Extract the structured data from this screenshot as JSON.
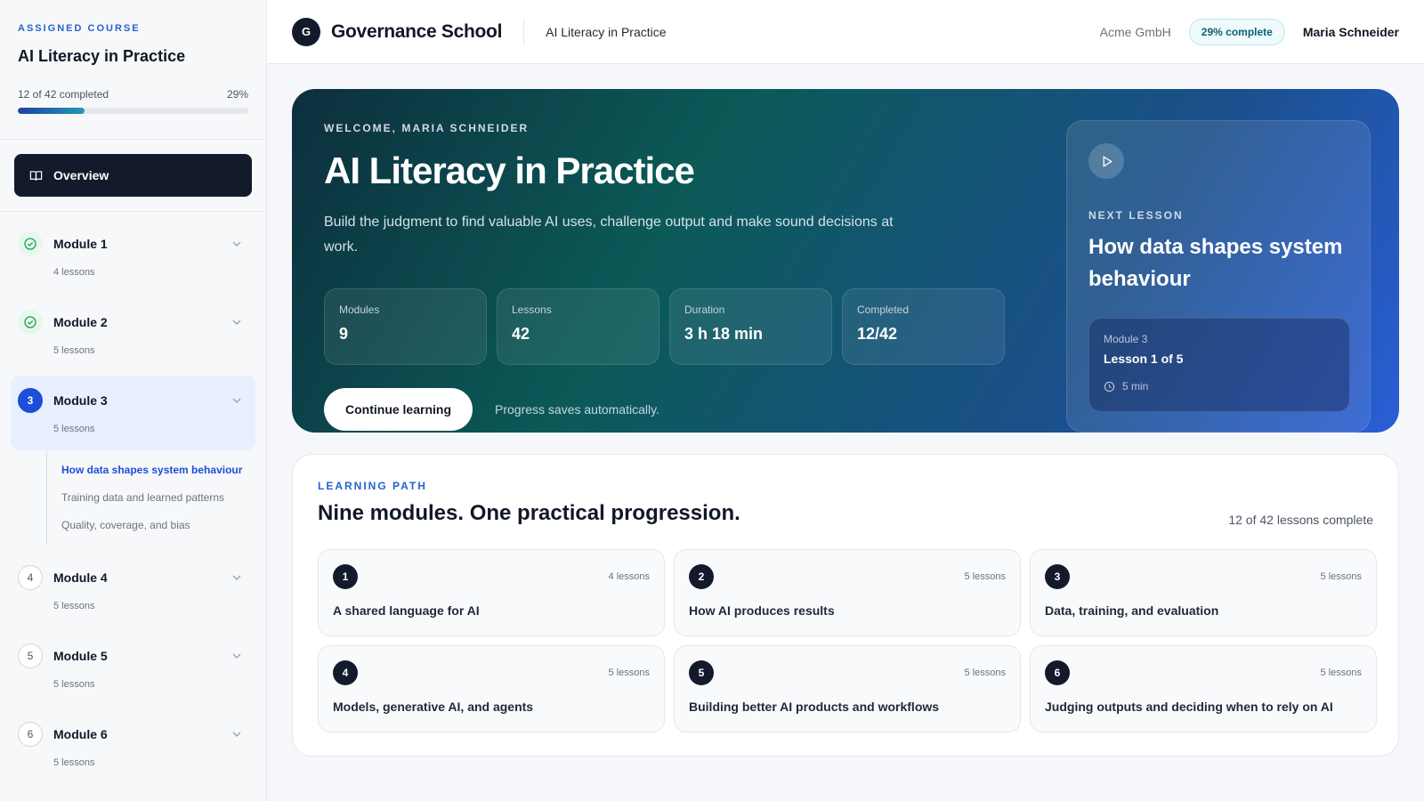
{
  "sidebar": {
    "eyebrow": "ASSIGNED COURSE",
    "title": "AI Literacy in Practice",
    "progress_text": "12 of 42 completed",
    "progress_percent": "29%",
    "progress_value": 0.29,
    "overview_label": "Overview",
    "modules": [
      {
        "badge": "",
        "name": "Module 1",
        "sub": "4 lessons",
        "state": "done"
      },
      {
        "badge": "",
        "name": "Module 2",
        "sub": "5 lessons",
        "state": "done"
      },
      {
        "badge": "3",
        "name": "Module 3",
        "sub": "5 lessons",
        "state": "current"
      },
      {
        "badge": "4",
        "name": "Module 4",
        "sub": "5 lessons",
        "state": "todo"
      },
      {
        "badge": "5",
        "name": "Module 5",
        "sub": "5 lessons",
        "state": "todo"
      },
      {
        "badge": "6",
        "name": "Module 6",
        "sub": "5 lessons",
        "state": "todo"
      }
    ],
    "lessons": [
      "How data shapes system behaviour",
      "Training data and learned patterns",
      "Quality, coverage, and bias"
    ]
  },
  "header": {
    "logo_letter": "G",
    "brand": "Governance School",
    "course": "AI Literacy in Practice",
    "org": "Acme GmbH",
    "pill": "29% complete",
    "user": "Maria Schneider"
  },
  "hero": {
    "eyebrow": "WELCOME, MARIA SCHNEIDER",
    "title": "AI Literacy in Practice",
    "description": "Build the judgment to find valuable AI uses, challenge output and make sound decisions at work.",
    "stats": [
      {
        "label": "Modules",
        "value": "9"
      },
      {
        "label": "Lessons",
        "value": "42"
      },
      {
        "label": "Duration",
        "value": "3 h 18 min"
      },
      {
        "label": "Completed",
        "value": "12/42"
      }
    ],
    "cta": "Continue learning",
    "cta_note": "Progress saves automatically.",
    "next": {
      "eyebrow": "NEXT LESSON",
      "title": "How data shapes system behaviour",
      "module": "Module 3",
      "lesson": "Lesson 1 of 5",
      "time": "5 min"
    }
  },
  "path": {
    "eyebrow": "LEARNING PATH",
    "title": "Nine modules. One practical progression.",
    "count": "12 of 42 lessons complete",
    "cards": [
      {
        "num": "1",
        "lessons": "4 lessons",
        "title": "A shared language for AI"
      },
      {
        "num": "2",
        "lessons": "5 lessons",
        "title": "How AI produces results"
      },
      {
        "num": "3",
        "lessons": "5 lessons",
        "title": "Data, training, and evaluation"
      },
      {
        "num": "4",
        "lessons": "5 lessons",
        "title": "Models, generative AI, and agents"
      },
      {
        "num": "5",
        "lessons": "5 lessons",
        "title": "Building better AI products and workflows"
      },
      {
        "num": "6",
        "lessons": "5 lessons",
        "title": "Judging outputs and deciding when to rely on AI"
      }
    ]
  },
  "colors": {
    "accent": "#1d4ed8",
    "dark": "#131a2b",
    "done": "#16a34a"
  }
}
